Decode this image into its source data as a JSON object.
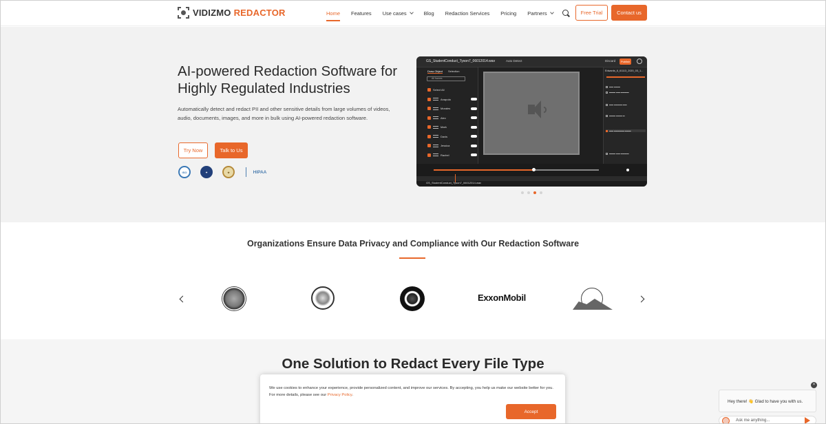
{
  "header": {
    "logo_a": "VIDIZMO",
    "logo_b": "REDACTOR",
    "nav": [
      "Home",
      "Features",
      "Use cases",
      "Blog",
      "Redaction Services",
      "Pricing",
      "Partners"
    ],
    "free_trial": "Free Trial",
    "contact": "Contact us"
  },
  "hero": {
    "title": "AI-powered Redaction Software for Highly Regulated Industries",
    "description": "Automatically detect and redact PII and other sensitive details from large volumes of videos, audio, documents, images, and more in bulk using AI-powered redaction software.",
    "try_now": "Try Now",
    "talk": "Talk to Us",
    "badge_hipaa": "HIPAA"
  },
  "screenshot": {
    "filename": "GS_StudentConduct_Tyson7_06012014.wav",
    "auto_detect": "Auto Detect",
    "discard": "Discard",
    "publish": "Publish",
    "tabs": [
      "Draw Object",
      "Selection"
    ],
    "search_placeholder": "All frames",
    "select_all": "Select All",
    "objects": [
      "Anapola",
      "Morales",
      "Alex",
      "Mark",
      "Davis",
      "Jessica",
      "Rachel"
    ],
    "right_title": "Edwards_6_61113_2020_03_1...",
    "footer_filename": "GS_StudentConduct_Tyson7_06012014.wav"
  },
  "carousel": {
    "active_index": 2,
    "count": 4
  },
  "orgs": {
    "title": "Organizations Ensure Data Privacy and Compliance with Our Redaction Software",
    "exxon": "ExxonMobil"
  },
  "solution": {
    "title": "One Solution to Redact Every File Type"
  },
  "cookie": {
    "text": "We use cookies to enhance your experience, provide personalized content, and improve our services. By accepting, you help us make our website better for you. For more details, please see our ",
    "link": "Privacy Policy",
    "accept": "Accept"
  },
  "chat": {
    "message": "Hey there! 👋 Glad to have you with us.",
    "placeholder": "Ask me anything..."
  },
  "colors": {
    "accent": "#e8672a"
  }
}
